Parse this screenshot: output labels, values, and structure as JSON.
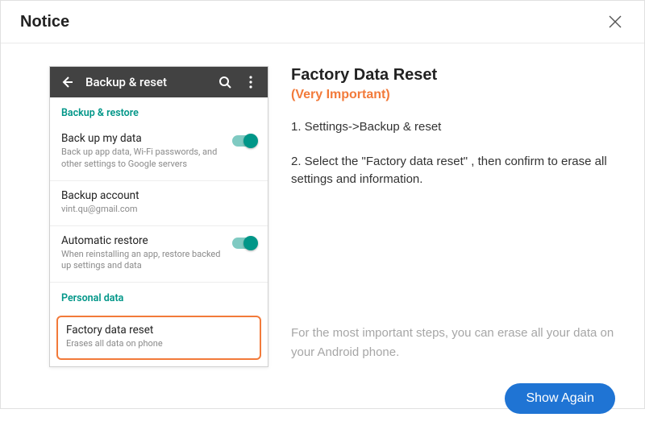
{
  "dialog": {
    "title": "Notice"
  },
  "phone": {
    "appbar_title": "Backup & reset",
    "section_backup": "Backup & restore",
    "section_personal": "Personal data",
    "rows": {
      "backup_data": {
        "title": "Back up my data",
        "sub": "Back up app data, Wi-Fi passwords, and other settings to Google servers"
      },
      "backup_account": {
        "title": "Backup account",
        "sub": "vint.qu@gmail.com"
      },
      "auto_restore": {
        "title": "Automatic restore",
        "sub": "When reinstalling an app, restore backed up settings and data"
      },
      "factory_reset": {
        "title": "Factory data reset",
        "sub": "Erases all data on phone"
      }
    }
  },
  "info": {
    "heading": "Factory Data Reset",
    "subheading": "(Very Important)",
    "step1": "1. Settings->Backup & reset",
    "step2": "2. Select the \"Factory data reset\" , then confirm to erase all settings and information.",
    "footnote": "For the most important steps, you can erase all your data on your Android phone."
  },
  "actions": {
    "show_again": "Show Again"
  }
}
